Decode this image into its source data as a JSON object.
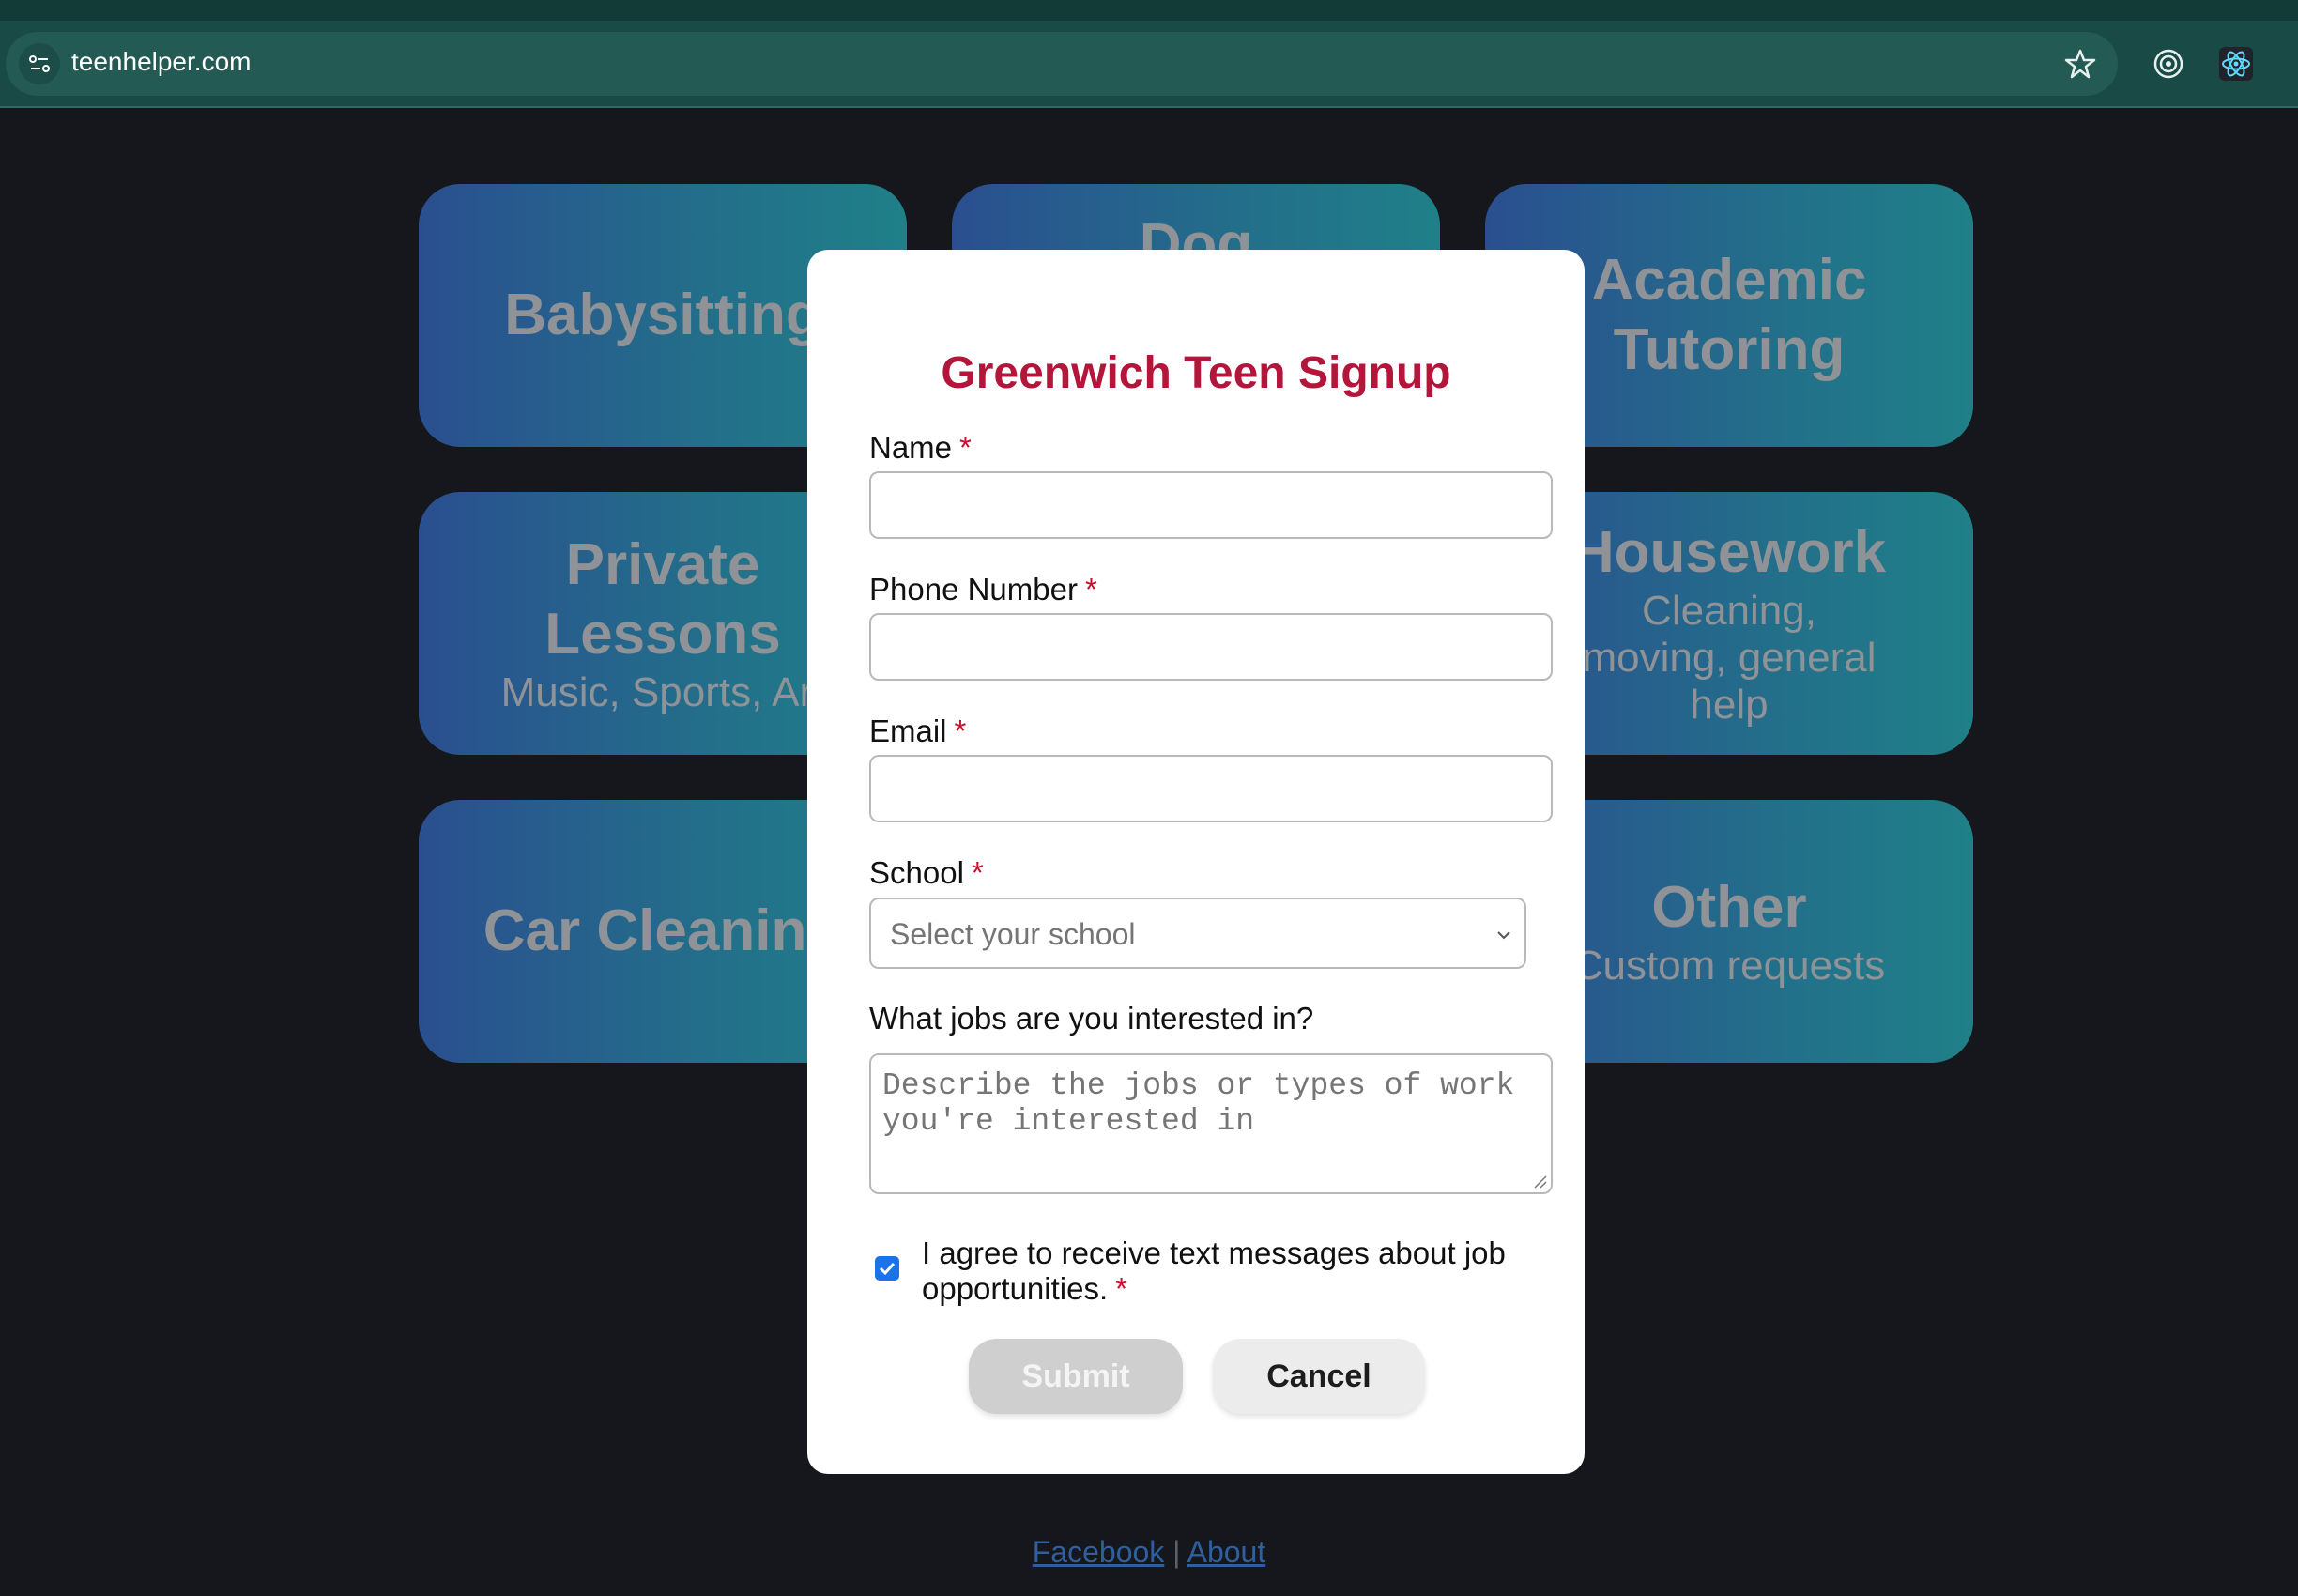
{
  "browser": {
    "url": "teenhelper.com",
    "icons": [
      "site-info-icon",
      "star-icon",
      "target-icon",
      "react-icon"
    ]
  },
  "tiles": [
    {
      "title": "Babysitting",
      "subtitle": ""
    },
    {
      "title": "Dog",
      "subtitle": ""
    },
    {
      "title": "Academic Tutoring",
      "subtitle": ""
    },
    {
      "title": "Private Lessons",
      "subtitle": "Music, Sports, Art"
    },
    {
      "title": "Housework",
      "subtitle": "Cleaning, moving, general help"
    },
    {
      "title": "Car Cleaning",
      "subtitle": ""
    },
    {
      "title": "Other",
      "subtitle": "Custom requests"
    }
  ],
  "modal": {
    "title": "Greenwich Teen Signup",
    "required_mark": "*",
    "name_label": "Name",
    "name_value": "",
    "phone_label": "Phone Number",
    "phone_value": "",
    "email_label": "Email",
    "email_value": "",
    "school_label": "School",
    "school_placeholder": "Select your school",
    "jobs_label": "What jobs are you interested in?",
    "jobs_placeholder": "Describe the jobs or types of work you're interested in",
    "consent_text": "I agree to receive text messages about job opportunities.",
    "consent_checked": true,
    "submit_label": "Submit",
    "cancel_label": "Cancel"
  },
  "footer": {
    "facebook_label": "Facebook",
    "separator": "|",
    "about_label": "About"
  },
  "colors": {
    "accent_title": "#b3163a",
    "required": "#c8102e",
    "checkbox": "#1a73e8",
    "tile_gradient_start": "#2a4f8f",
    "tile_gradient_end": "#1f8088"
  }
}
